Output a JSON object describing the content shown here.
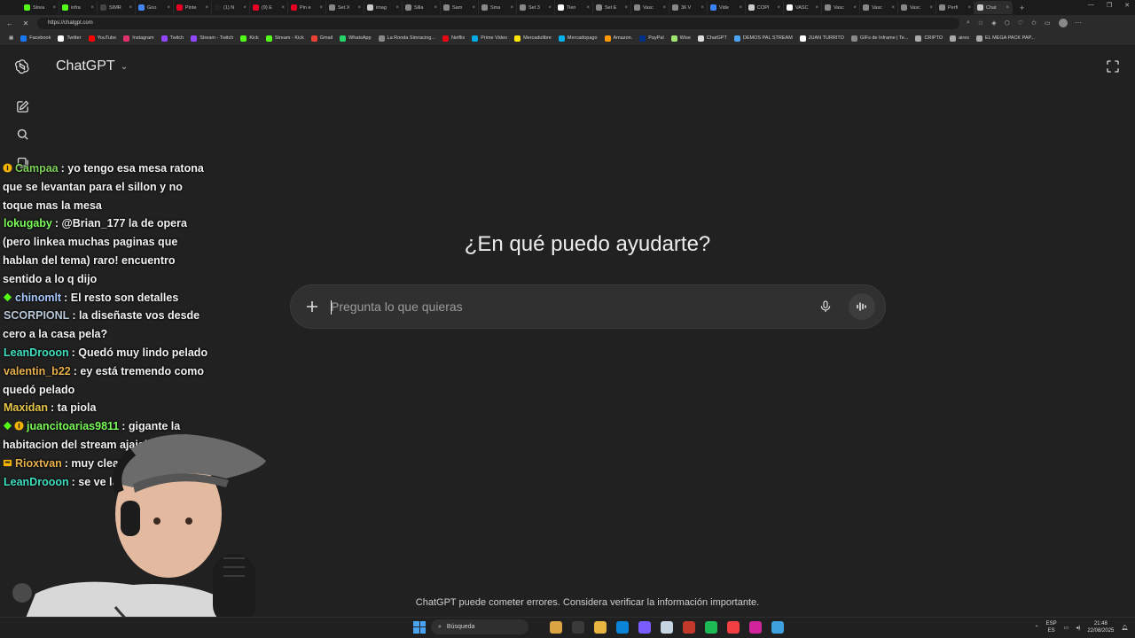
{
  "browser": {
    "tabs": [
      {
        "label": "Strea",
        "color": "#53fc18"
      },
      {
        "label": "infra",
        "color": "#53fc18"
      },
      {
        "label": "SIMR",
        "color": "#444444"
      },
      {
        "label": "Goo",
        "color": "#4285f4"
      },
      {
        "label": "Pinte",
        "color": "#e60023"
      },
      {
        "label": "(1) N",
        "color": "#222222"
      },
      {
        "label": "(9) E",
        "color": "#e60023"
      },
      {
        "label": "Pin e",
        "color": "#e60023"
      },
      {
        "label": "Set X",
        "color": "#888888"
      },
      {
        "label": "imag",
        "color": "#cccccc"
      },
      {
        "label": "Silla",
        "color": "#888888"
      },
      {
        "label": "Sam",
        "color": "#888888"
      },
      {
        "label": "Sma",
        "color": "#888888"
      },
      {
        "label": "Set 3",
        "color": "#888888"
      },
      {
        "label": "Tien",
        "color": "#ffffff"
      },
      {
        "label": "Set E",
        "color": "#888888"
      },
      {
        "label": "Vasc",
        "color": "#888888"
      },
      {
        "label": "36 V",
        "color": "#888888"
      },
      {
        "label": "Vide",
        "color": "#3b82f6"
      },
      {
        "label": "COPI",
        "color": "#cccccc"
      },
      {
        "label": "VASC",
        "color": "#ffffff"
      },
      {
        "label": "Vasc",
        "color": "#888888"
      },
      {
        "label": "Vasc",
        "color": "#888888"
      },
      {
        "label": "Vasc",
        "color": "#888888"
      },
      {
        "label": "Perfi",
        "color": "#888888"
      },
      {
        "label": "Chat",
        "color": "#cccccc"
      }
    ],
    "new_tab": "+",
    "window_controls": [
      "—",
      "❐",
      "✕"
    ],
    "url": "https://chatgpt.com",
    "bookmarks": [
      {
        "label": "Facebook",
        "color": "#1877f2"
      },
      {
        "label": "Twitter",
        "color": "#ffffff"
      },
      {
        "label": "YouTube",
        "color": "#ff0000"
      },
      {
        "label": "Instagram",
        "color": "#e1306c"
      },
      {
        "label": "Twitch",
        "color": "#9146ff"
      },
      {
        "label": "Stream - Twitch",
        "color": "#9146ff"
      },
      {
        "label": "Kick",
        "color": "#53fc18"
      },
      {
        "label": "Stream - Kick",
        "color": "#53fc18"
      },
      {
        "label": "Gmail",
        "color": "#ea4335"
      },
      {
        "label": "WhatsApp",
        "color": "#25d366"
      },
      {
        "label": "La Ronda Simracing...",
        "color": "#888888"
      },
      {
        "label": "Netflix",
        "color": "#e50914"
      },
      {
        "label": "Prime Video",
        "color": "#00a8e1"
      },
      {
        "label": "Mercadolibre",
        "color": "#ffe600"
      },
      {
        "label": "Mercadopago",
        "color": "#00b1ea"
      },
      {
        "label": "Amazon.",
        "color": "#ff9900"
      },
      {
        "label": "PayPal",
        "color": "#003087"
      },
      {
        "label": "Wise",
        "color": "#9fe870"
      },
      {
        "label": "ChatGPT",
        "color": "#dddddd"
      },
      {
        "label": "DEMOS PAL STREAM",
        "color": "#4aa3f0"
      },
      {
        "label": "JUAN TURRITO",
        "color": "#ffffff"
      },
      {
        "label": "GIFs de Inframe | Te...",
        "color": "#888888"
      },
      {
        "label": "CRIPTO",
        "color": "#aaaaaa"
      },
      {
        "label": "aires",
        "color": "#aaaaaa"
      },
      {
        "label": "EL MEGA PACK PAP...",
        "color": "#aaaaaa"
      }
    ]
  },
  "app": {
    "title": "ChatGPT",
    "title_chevron": "⌄",
    "hero": "¿En qué puedo ayudarte?",
    "composer_placeholder": "Pregunta lo que quieras",
    "disclaimer": "ChatGPT puede cometer errores. Considera verificar la información importante."
  },
  "chat": [
    {
      "user": "Campaa",
      "color": "#7fd05a",
      "badge": "sub",
      "text": ": yo tengo esa mesa ratona que se levantan para el sillon y no toque mas la mesa"
    },
    {
      "user": "lokugaby",
      "color": "#7cfc5a",
      "badge": "",
      "text": ": @Brian_177 la de opera (pero linkea muchas paginas que hablan del tema) raro! encuentro sentido a lo q dijo"
    },
    {
      "user": "chinomlt",
      "color": "#a7c8ff",
      "badge": "gem",
      "text": ": El resto son detalles"
    },
    {
      "user": "SCORPIONL",
      "color": "#b8c8d8",
      "badge": "",
      "text": ": la diseñaste vos desde cero a la casa pela?"
    },
    {
      "user": "LeanDrooon",
      "color": "#3fe0c0",
      "badge": "",
      "text": ": Quedó muy lindo pelado"
    },
    {
      "user": "valentin_b22",
      "color": "#e8b04a",
      "badge": "",
      "text": ": ey está tremendo como quedó pelado"
    },
    {
      "user": "Maxidan",
      "color": "#e8c84a",
      "badge": "",
      "text": ": ta piola"
    },
    {
      "user": "juancitoarias9811",
      "color": "#7cfc5a",
      "badge": "gem-sub",
      "text": ": gigante la habitacion del stream ajajajj"
    },
    {
      "user": "Rioxtvan",
      "color": "#e8b04a",
      "badge": "box",
      "text": ": muy clean"
    },
    {
      "user": "LeanDrooon",
      "color": "#3fe0c0",
      "badge": "",
      "text": ": se ve la chim vecinos?"
    }
  ],
  "taskbar": {
    "search_label": "Búsqueda",
    "apps": [
      "#d9a441",
      "#3a3a3a",
      "#e8b640",
      "#0a84d6",
      "#7b5cff",
      "#c7d5e0",
      "#c0392b",
      "#1db954",
      "#f23f42",
      "#d0249a",
      "#3fa0e0"
    ],
    "lang_top": "ESP",
    "lang_bottom": "ES",
    "time": "21:48",
    "date": "22/08/2025"
  }
}
